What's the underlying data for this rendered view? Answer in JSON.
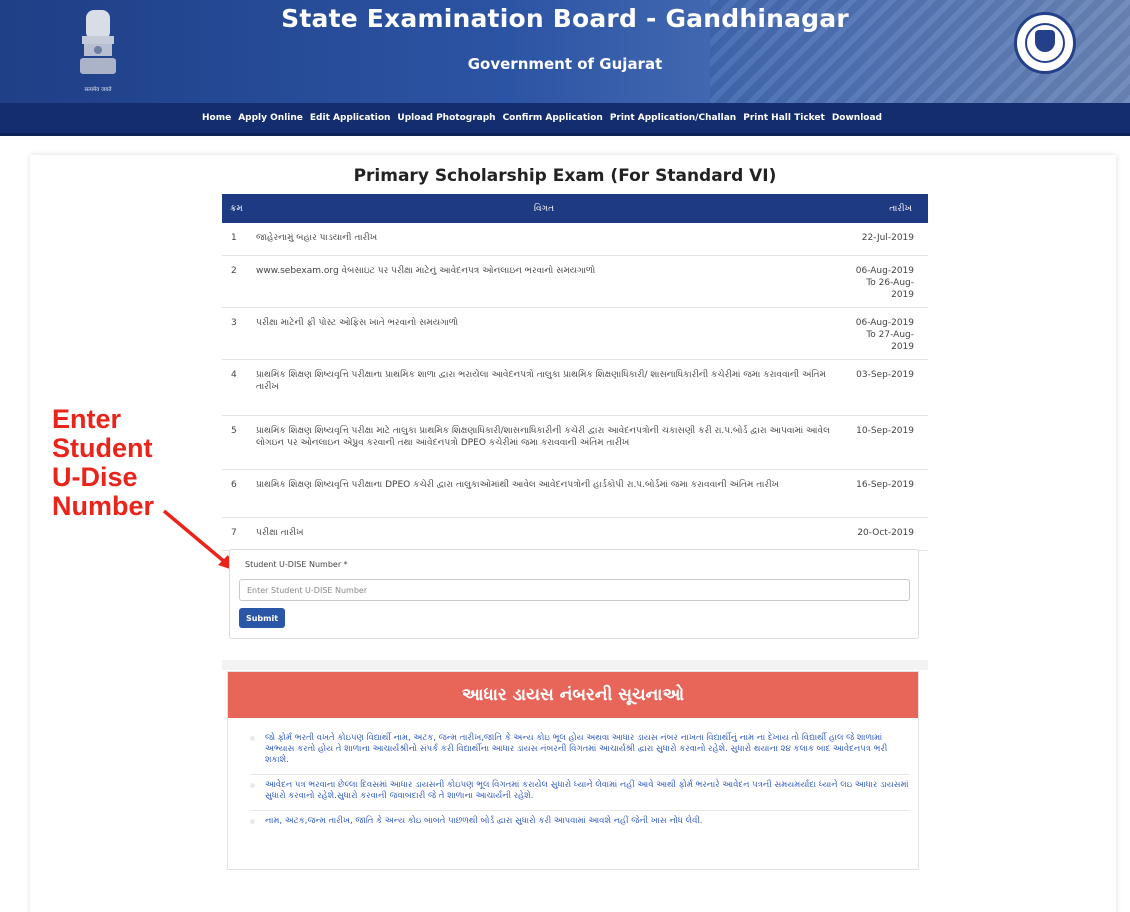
{
  "header": {
    "title": "State Examination Board - Gandhinagar",
    "subtitle": "Government of Gujarat",
    "emblem_motto": "सत्यमेव जयते"
  },
  "nav": {
    "items": [
      "Home",
      "Apply Online",
      "Edit Application",
      "Upload Photograph",
      "Confirm Application",
      "Print Application/Challan",
      "Print Hall Ticket",
      "Download"
    ]
  },
  "annotation": {
    "lines": [
      "Enter",
      "Student",
      "U-Dise",
      "Number"
    ],
    "color": "#e8241b"
  },
  "exam": {
    "title": "Primary Scholarship Exam (For Standard VI)"
  },
  "schedule": {
    "headers": {
      "num": "ક્રમ",
      "desc": "વિગત",
      "date": "તારીખ"
    },
    "rows": [
      {
        "num": "1",
        "desc": "જાહેરનામું બહાર પાડયાની તારીખ",
        "date": "22-Jul-2019"
      },
      {
        "num": "2",
        "desc": "www.sebexam.org વેબસાઇટ પર પરીક્ષા માટેનું આવેદનપત્ર ઓનલાઇન ભરવાનો સમયગાળો",
        "date": "06-Aug-2019 To 26-Aug-2019"
      },
      {
        "num": "3",
        "desc": "પરીક્ષા માટેની ફી પોસ્ટ ઓફિસ ખાતે ભરવાનો સમયગાળો",
        "date": "06-Aug-2019 To 27-Aug-2019"
      },
      {
        "num": "4",
        "desc": "પ્રાથમિક શિક્ષણ શિષ્યવૃત્તિ પરીક્ષાના પ્રાથમિક શાળા દ્વારા ભરાયેલા આવેદનપત્રો તાલુકા પ્રાથમિક શિક્ષણાધિકારી/ શાસનાધિકારીની કચેરીમાં જમા કરાવવાની અંતિમ તારીખ",
        "date": "03-Sep-2019"
      },
      {
        "num": "5",
        "desc": "પ્રાથમિક શિક્ષણ શિષ્યવૃત્તિ પરીક્ષા માટે તાલુકા પ્રાથમિક શિક્ષણાધિકારી/શાસનાધિકારીની કચેરી દ્વારા આવેદનપત્રોની ચકાસણી કરી રા.પ.બોર્ડ દ્વારા આપવામાં આવેલ લોગઇન પર ઓનલાઇન એપ્રુવ કરવાની તથા આવેદનપત્રો DPEO કચેરીમાં જમા કરાવવાની અંતિમ તારીખ",
        "date": "10-Sep-2019"
      },
      {
        "num": "6",
        "desc": "પ્રાથમિક શિક્ષણ શિષ્યવૃત્તિ પરીક્ષાના DPEO કચેરી દ્વારા તાલુકાઓમાંથી આવેલ આવેદનપત્રોની હાર્ડકોપી રા.પ.બોર્ડમાં જમા કરાવવાની અંતિમ તારીખ",
        "date": "16-Sep-2019"
      },
      {
        "num": "7",
        "desc": "પરીક્ષા તારીખ",
        "date": "20-Oct-2019"
      }
    ]
  },
  "form": {
    "label": "Student U-DISE Number *",
    "placeholder": "Enter Student U-DISE Number",
    "value": "",
    "submit_label": "Submit"
  },
  "notice": {
    "title": "આધાર ડાયસ નંબરની સૂચનાઓ",
    "items": [
      "જો ફોર્મ ભરતી વખતે કોઇપણ વિદ્યાર્થી નામ, અટક, જન્મ તારીખ,જાતિ કે અન્ય કોઇ ભૂલ હોય અથવા આધાર ડાયસ નંબર નાખતા વિદ્યાર્થીનું નામ ના દેખાય તો વિદ્યાર્થી હાલ જે શાળામાં અભ્યાસ કરતો હોય તે શાળાના આચાર્યશ્રીનો સંપર્ક કરી વિદ્યાર્થીના આધાર ડાયસ નંબરની વિગતમાં આચાર્યશ્રી દ્વારા સુધારો કરવાનો રહેશે. સુધારો થયાના ૨૪ કલાક બાદ આવેદનપત્ર ભરી શકાશે.",
      "આવેદન પત્ર ભરવાના છેલ્લા દિવસમાં આધાર ડાયસની કોઇપણ ભૂલ વિગતમાં કરાયેલ સુધારો ધ્યાને લેવામાં નહીં આવે આથી ફોર્મ ભરનારે આવેદન પત્રની સમયમર્યાદા ધ્યાને લઇ આધાર ડાયસમાં સુધારો કરવાનો રહેશે.સુધારો કરવાની જવાબદારી જે તે શાળાના આચાર્યની રહેશે.",
      "નામ, અટક,જન્મ તારીખ, જાતિ કે અન્ય કોઇ બાબતે પાછળથી બોર્ડ દ્વારા સુધારો કરી આપવામાં આવશે નહીં જેની ખાસ નોંધ લેવી."
    ]
  }
}
